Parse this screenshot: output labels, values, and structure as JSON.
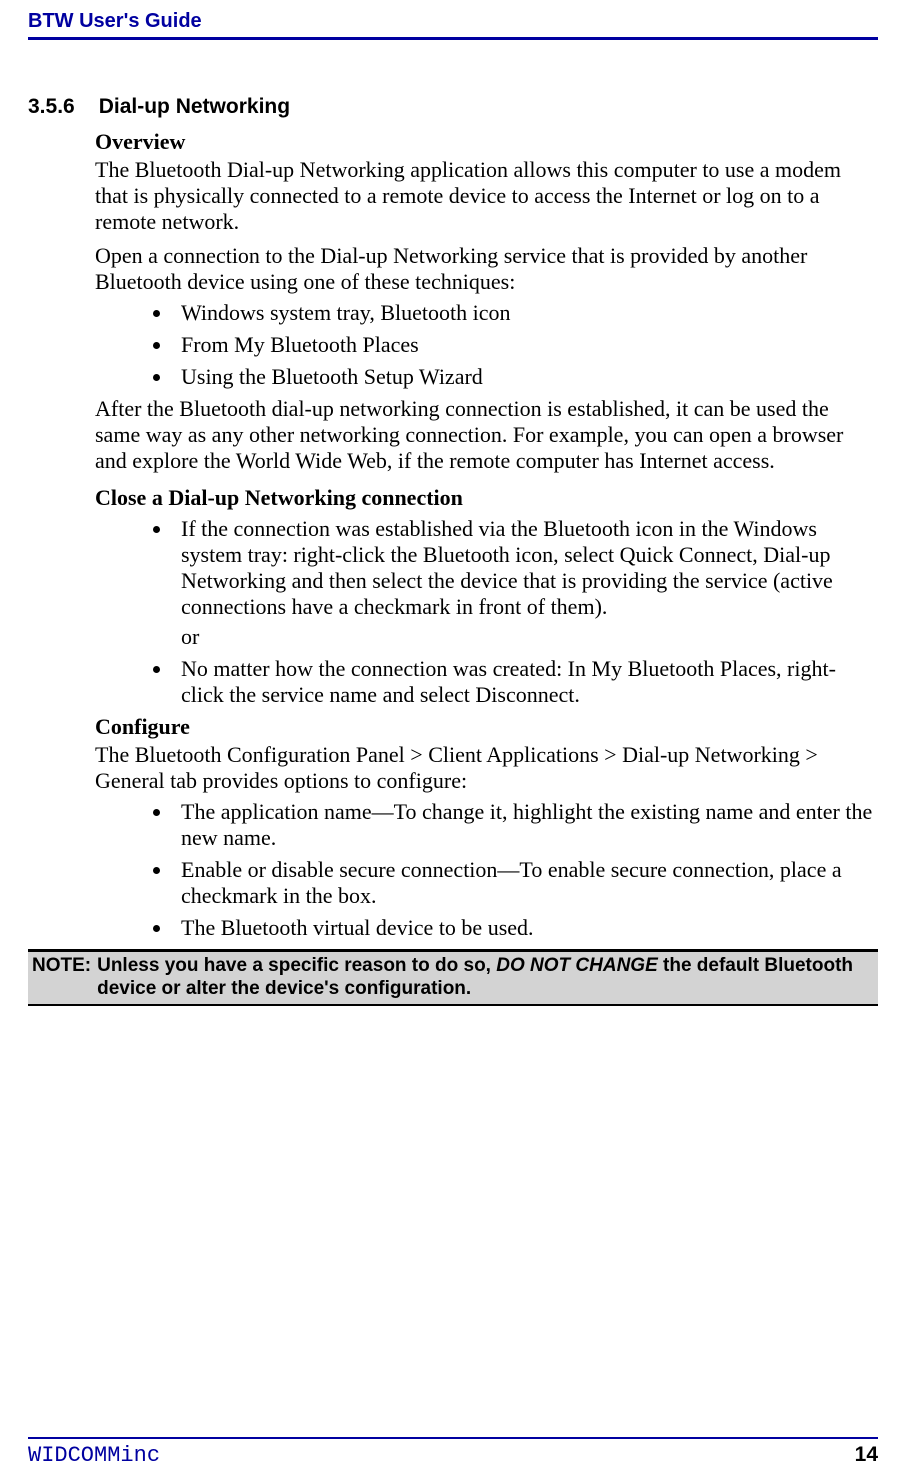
{
  "header": {
    "title": "BTW User's Guide"
  },
  "section": {
    "number": "3.5.6",
    "title": "Dial-up Networking"
  },
  "overview": {
    "heading": "Overview",
    "p1": "The Bluetooth Dial-up Networking application allows this computer to use a modem that is physically connected to a remote device to access the Internet or log on to a remote network.",
    "p2": "Open a connection to the Dial-up Networking service that is provided by another Bluetooth device using one of these techniques:",
    "bullets": [
      "Windows system tray, Bluetooth icon",
      "From My Bluetooth Places",
      "Using the Bluetooth Setup Wizard"
    ],
    "p3": "After the Bluetooth dial-up networking connection is established, it can be used the same way as any other networking connection. For example, you can open a browser and explore the World Wide Web, if the remote computer has Internet access."
  },
  "close": {
    "heading": "Close a Dial-up Networking connection",
    "b1": "If the connection was established via the Bluetooth icon in the Windows system tray: right-click the Bluetooth icon, select Quick Connect, Dial-up Networking and then select the device that is providing the service (active connections have a checkmark in front of them).",
    "or": "or",
    "b2": "No matter how the connection was created: In My Bluetooth Places, right-click the service name and select Disconnect."
  },
  "configure": {
    "heading": "Configure",
    "p1": "The Bluetooth Configuration Panel > Client Applications > Dial-up Networking > General tab provides options to configure:",
    "bullets": [
      "The application name—To change it, highlight the existing name and enter the new name.",
      "Enable or disable secure connection—To enable secure connection, place a checkmark in the box.",
      "The Bluetooth virtual device to be used."
    ]
  },
  "note": {
    "label": "NOTE:",
    "pre": "Unless you have a specific reason to do so, ",
    "em": "DO NOT CHANGE",
    "post": " the default Bluetooth device or alter the device's configuration."
  },
  "footer": {
    "left": "WIDCOMMinc",
    "right": "14"
  }
}
